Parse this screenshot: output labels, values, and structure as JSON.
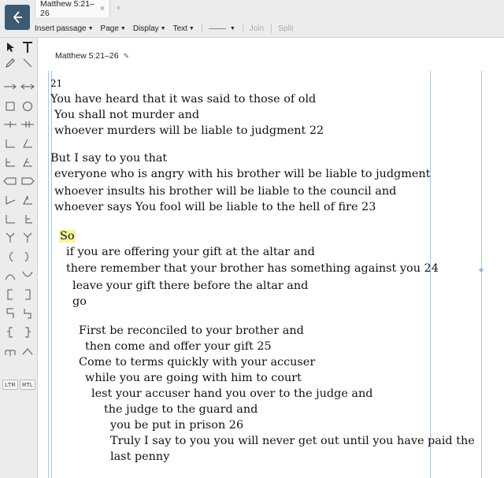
{
  "tab": {
    "title": "Matthew 5:21–26",
    "close_glyph": "×",
    "new_tab_glyph": "+"
  },
  "toolbar": {
    "insert_passage": "Insert passage",
    "page": "Page",
    "display": "Display",
    "text": "Text",
    "join": "Join",
    "split": "Split"
  },
  "palette": {
    "ltr": "LTR",
    "rtl": "RTL"
  },
  "document": {
    "passage_ref": "Matthew 5:21–26",
    "verse_start": "21",
    "lines": [
      "You have heard that it was said to those of old",
      "You shall not murder and",
      "whoever murders will be liable to judgment 22",
      "But I say to you that",
      "everyone who is angry with his brother will be liable to judgment",
      "whoever insults his brother will be liable to the council and",
      "whoever says You fool will be liable to the hell of fire 23",
      "So",
      "if you are offering your gift at the altar and",
      "there remember that your brother has something against you 24",
      "leave your gift there before the altar and",
      "go",
      "First be reconciled to your brother and",
      "then come and offer your gift 25",
      "Come to terms quickly with your accuser",
      "while you are going with him to court",
      "lest your accuser hand you over to the judge and",
      "the judge to the guard and",
      "you be put in prison 26",
      "Truly I say to you you will never get out until you have paid the",
      "last penny"
    ]
  },
  "colors": {
    "highlight": "#f7f3a0",
    "guide": "#a9c4de",
    "logo": "#3d5a73"
  }
}
